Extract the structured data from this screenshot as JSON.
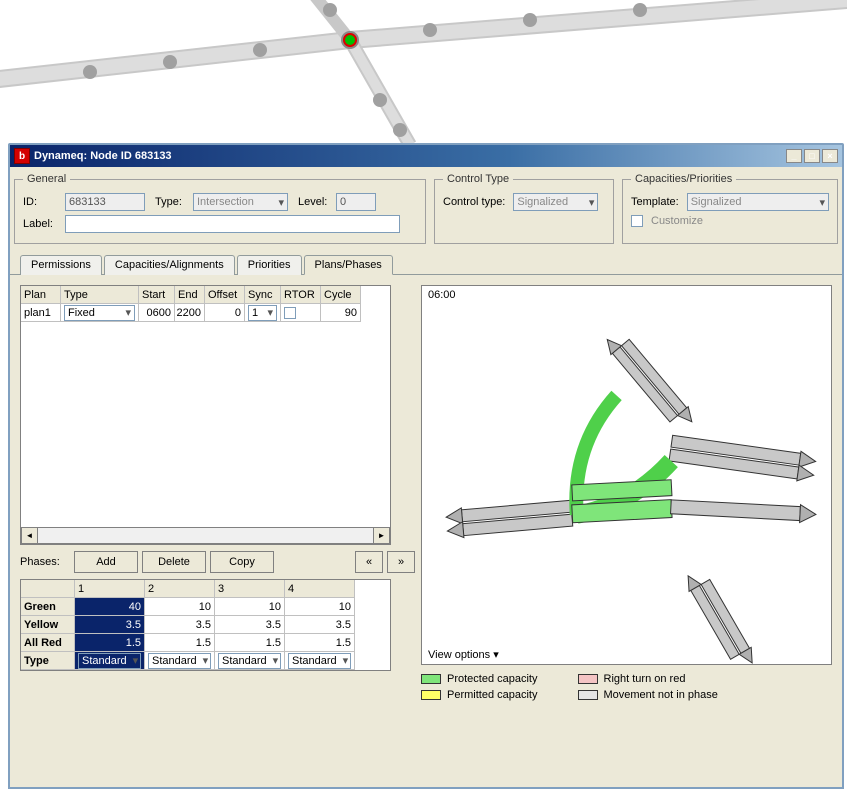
{
  "window": {
    "title": "Dynameq: Node ID 683133"
  },
  "general": {
    "legend": "General",
    "id_label": "ID:",
    "id_value": "683133",
    "type_label": "Type:",
    "type_value": "Intersection",
    "level_label": "Level:",
    "level_value": "0",
    "label_label": "Label:",
    "label_value": ""
  },
  "control_type": {
    "legend": "Control Type",
    "label": "Control type:",
    "value": "Signalized"
  },
  "capacities": {
    "legend": "Capacities/Priorities",
    "template_label": "Template:",
    "template_value": "Signalized",
    "customize_label": "Customize"
  },
  "tabs": {
    "permissions": "Permissions",
    "cap_align": "Capacities/Alignments",
    "priorities": "Priorities",
    "plans": "Plans/Phases"
  },
  "plan_grid": {
    "headers": {
      "plan": "Plan",
      "type": "Type",
      "start": "Start",
      "end": "End",
      "offset": "Offset",
      "sync": "Sync",
      "rtor": "RTOR",
      "cycle": "Cycle"
    },
    "rows": [
      {
        "plan": "plan1",
        "type": "Fixed",
        "start": "0600",
        "end": "2200",
        "offset": "0",
        "sync": "1",
        "rtor": "",
        "cycle": "90"
      }
    ]
  },
  "phases_bar": {
    "label": "Phases:",
    "add": "Add",
    "delete": "Delete",
    "copy": "Copy",
    "prev": "«",
    "next": "»"
  },
  "phase_table": {
    "row_labels": {
      "green": "Green",
      "yellow": "Yellow",
      "allred": "All Red",
      "type": "Type"
    },
    "col_headers": [
      "1",
      "2",
      "3",
      "4"
    ],
    "green": [
      40,
      10,
      10,
      10
    ],
    "yellow": [
      3.5,
      3.5,
      3.5,
      3.5
    ],
    "allred": [
      1.5,
      1.5,
      1.5,
      1.5
    ],
    "type": [
      "Standard",
      "Standard",
      "Standard",
      "Standard"
    ]
  },
  "diagram": {
    "time": "06:00",
    "view_options": "View options"
  },
  "legend_labels": {
    "protected": "Protected capacity",
    "permitted": "Permitted capacity",
    "rtor": "Right turn on red",
    "notin": "Movement not in phase"
  }
}
